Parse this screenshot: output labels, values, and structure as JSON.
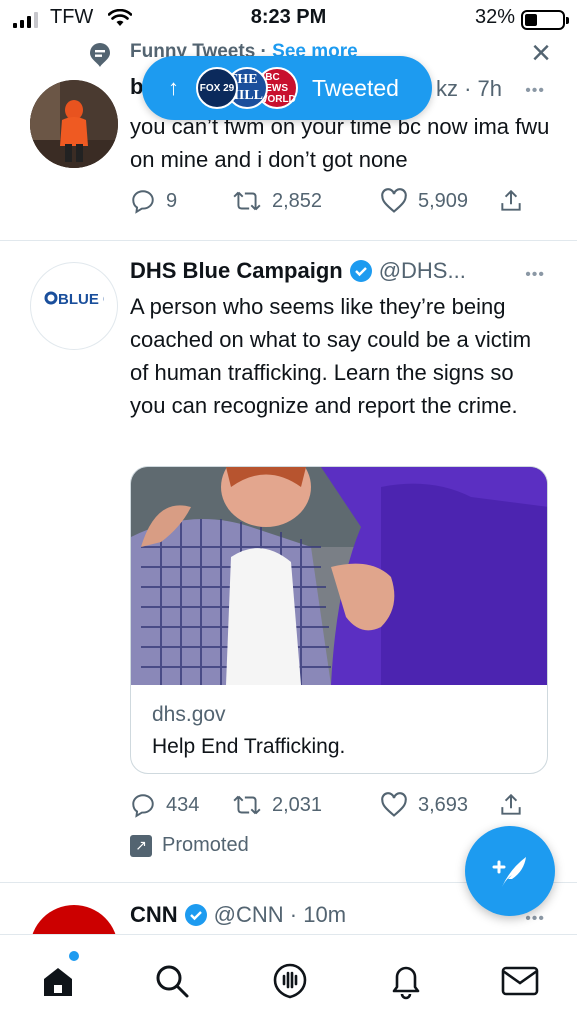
{
  "status_bar": {
    "carrier": "TFW",
    "time": "8:23 PM",
    "battery_percent": "32%",
    "battery_level": 0.32
  },
  "topic_header": {
    "text": "Funny Tweets",
    "separator": " · ",
    "see_more": "See more"
  },
  "tweeted_pill": {
    "label": "Tweeted",
    "arrow": "↑",
    "avatars": [
      "FOX 29",
      "THE HILL",
      "BBC NEWS WORLD"
    ]
  },
  "tweets": [
    {
      "name": "b",
      "handle_time": "kz · 7h",
      "more": "•••",
      "body": "you can’t fwm on your time bc now ima fwu on mine and i don’t got none",
      "replies": "9",
      "retweets": "2,852",
      "likes": "5,909"
    },
    {
      "name": "DHS Blue Campaign",
      "handle": "@DHS...",
      "more": "•••",
      "avatar_text": "BLUE CAMPAIGN",
      "body": "A person who seems like they’re being coached on what to say could be a victim of human trafficking. Learn the signs so you can recognize and report the crime.",
      "card_domain": "dhs.gov",
      "card_title": "Help End Trafficking.",
      "replies": "434",
      "retweets": "2,031",
      "likes": "3,693",
      "promoted": "Promoted"
    },
    {
      "name": "CNN",
      "handle_time": "@CNN · 10m",
      "more": "•••"
    }
  ],
  "colors": {
    "accent": "#1d9bf0",
    "text": "#0f1419",
    "secondary": "#536471",
    "verified": "#1d9bf0"
  },
  "tab_bar": [
    "home-icon",
    "search-icon",
    "spaces-icon",
    "notifications-icon",
    "messages-icon"
  ]
}
